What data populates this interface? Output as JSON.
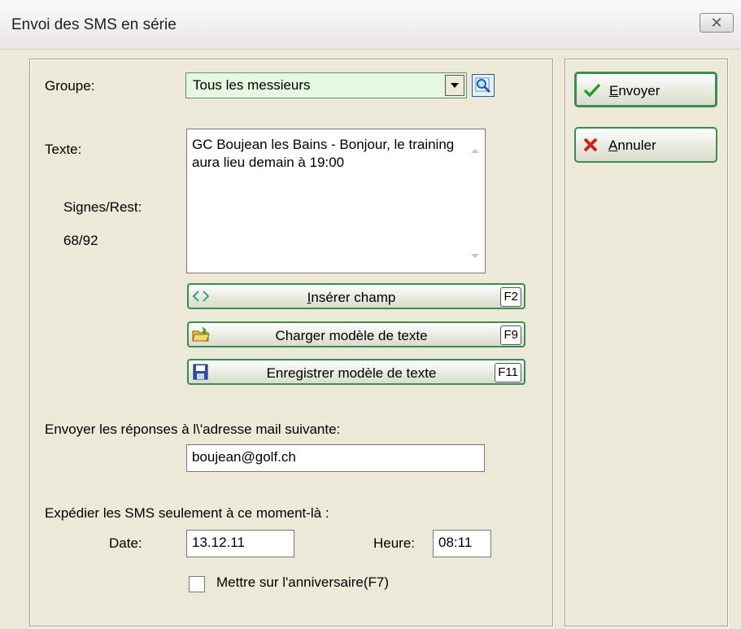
{
  "window": {
    "title": "Envoi des SMS en série",
    "close_icon": "close-icon"
  },
  "form": {
    "groupe_label": "Groupe:",
    "groupe_value": "Tous les messieurs",
    "texte_label": "Texte:",
    "signes_label": "Signes/Rest:",
    "signes_value": "68/92",
    "message_text": "GC Boujean les Bains - Bonjour, le training aura lieu demain à 19:00",
    "buttons": {
      "insert_prefix": "I",
      "insert_rest": "nsérer champ",
      "insert_key": "F2",
      "load": "Charger modèle de texte",
      "load_key": "F9",
      "save": "Enregistrer modèle de texte",
      "save_key": "F11"
    },
    "reply_label": "Envoyer les réponses à l\\'adresse mail suivante:",
    "reply_email": "boujean@golf.ch",
    "schedule_label": "Expédier les SMS seulement à ce moment-là :",
    "date_label": "Date:",
    "date_value": "13.12.11",
    "heure_label": "Heure:",
    "heure_value": "08:11",
    "birthday_checkbox_label": "Mettre sur l'anniversaire(F7)",
    "birthday_checked": false
  },
  "actions": {
    "send_prefix": "E",
    "send_rest": "nvoyer",
    "cancel_prefix": "A",
    "cancel_rest": "nnuler"
  },
  "colors": {
    "accent_green": "#3c8b4f",
    "combo_bg": "#e5f8e1",
    "window_bg": "#ece9d8"
  }
}
